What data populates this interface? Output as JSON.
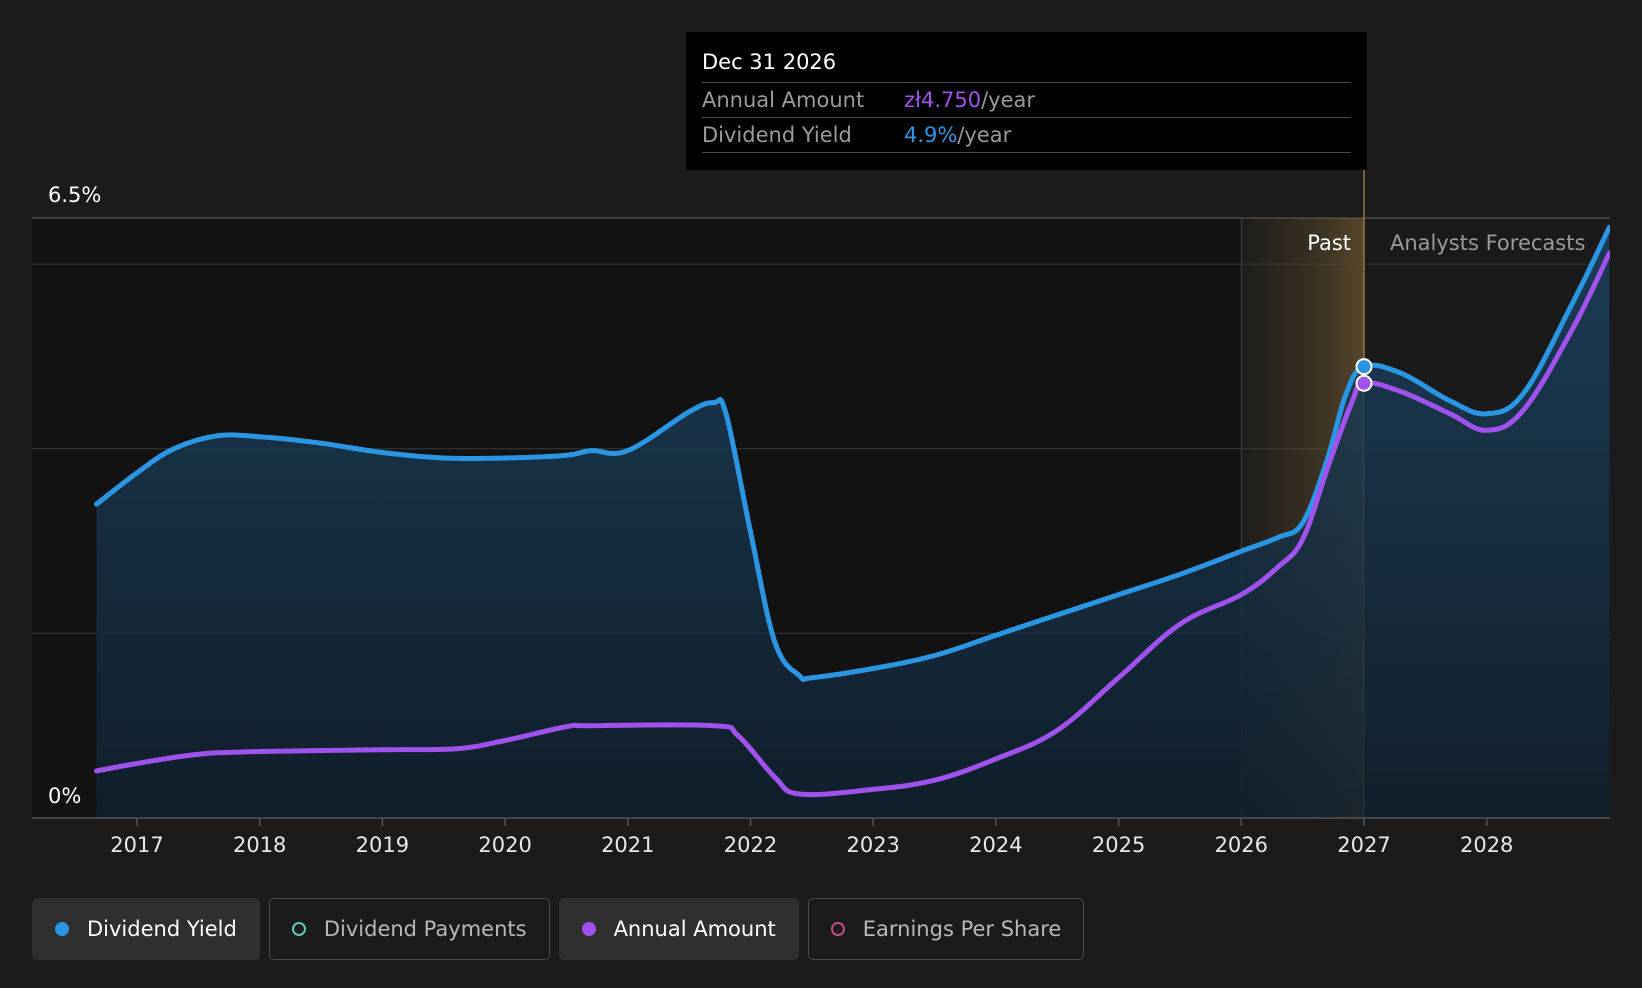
{
  "tooltip": {
    "date": "Dec 31 2026",
    "annual_amount_label": "Annual Amount",
    "annual_amount_value": "zł4.750",
    "annual_amount_unit": "/year",
    "dividend_yield_label": "Dividend Yield",
    "dividend_yield_value": "4.9%",
    "dividend_yield_unit": "/year"
  },
  "legend": [
    {
      "label": "Dividend Yield",
      "active": true,
      "color": "#2a96e3"
    },
    {
      "label": "Dividend Payments",
      "active": false,
      "color": "#5fc8b8"
    },
    {
      "label": "Annual Amount",
      "active": true,
      "color": "#a052ec"
    },
    {
      "label": "Earnings Per Share",
      "active": false,
      "color": "#c04c8c"
    }
  ],
  "chart_data": {
    "type": "line",
    "title": "",
    "xlabel": "",
    "ylabel": "",
    "ylim": [
      0,
      6.5
    ],
    "xlim": [
      2016.5,
      2029.0
    ],
    "y_tick_labels": [
      {
        "value": 6.5,
        "label": "6.5%"
      },
      {
        "value": 0,
        "label": "0%"
      }
    ],
    "grid_values": [
      6.0,
      4.0,
      2.0
    ],
    "x_ticks": [
      2017,
      2018,
      2019,
      2020,
      2021,
      2022,
      2023,
      2024,
      2025,
      2026,
      2027,
      2028
    ],
    "regions": {
      "past_label": "Past",
      "forecast_label": "Analysts Forecasts",
      "past_start": 2026.0,
      "divider": 2027.0
    },
    "highlight_x": 2027.0,
    "series": [
      {
        "name": "Dividend Yield",
        "color": "#2a96e3",
        "fill": true,
        "points": [
          [
            2016.67,
            3.4
          ],
          [
            2017.0,
            3.74
          ],
          [
            2017.3,
            4.0
          ],
          [
            2017.65,
            4.14
          ],
          [
            2018.0,
            4.13
          ],
          [
            2018.5,
            4.06
          ],
          [
            2019.0,
            3.96
          ],
          [
            2019.5,
            3.9
          ],
          [
            2020.0,
            3.9
          ],
          [
            2020.5,
            3.93
          ],
          [
            2020.7,
            3.98
          ],
          [
            2021.0,
            3.98
          ],
          [
            2021.5,
            4.4
          ],
          [
            2021.7,
            4.5
          ],
          [
            2021.8,
            4.38
          ],
          [
            2022.0,
            3.1
          ],
          [
            2022.2,
            1.9
          ],
          [
            2022.4,
            1.54
          ],
          [
            2022.5,
            1.52
          ],
          [
            2023.0,
            1.62
          ],
          [
            2023.5,
            1.76
          ],
          [
            2024.0,
            1.98
          ],
          [
            2024.5,
            2.2
          ],
          [
            2025.0,
            2.42
          ],
          [
            2025.5,
            2.64
          ],
          [
            2026.0,
            2.89
          ],
          [
            2026.3,
            3.04
          ],
          [
            2026.5,
            3.2
          ],
          [
            2026.7,
            3.88
          ],
          [
            2026.85,
            4.58
          ],
          [
            2027.0,
            4.89
          ],
          [
            2027.3,
            4.82
          ],
          [
            2027.7,
            4.52
          ],
          [
            2028.0,
            4.38
          ],
          [
            2028.3,
            4.6
          ],
          [
            2028.7,
            5.58
          ],
          [
            2029.0,
            6.4
          ]
        ]
      },
      {
        "name": "Annual Amount",
        "color": "#a052ec",
        "fill": false,
        "points": [
          [
            2016.67,
            0.51
          ],
          [
            2017.0,
            0.59
          ],
          [
            2017.5,
            0.69
          ],
          [
            2018.0,
            0.72
          ],
          [
            2019.0,
            0.74
          ],
          [
            2019.6,
            0.75
          ],
          [
            2020.0,
            0.84
          ],
          [
            2020.5,
            0.99
          ],
          [
            2020.7,
            1.0
          ],
          [
            2021.7,
            1.0
          ],
          [
            2021.9,
            0.89
          ],
          [
            2022.2,
            0.44
          ],
          [
            2022.4,
            0.26
          ],
          [
            2023.0,
            0.31
          ],
          [
            2023.5,
            0.41
          ],
          [
            2024.0,
            0.64
          ],
          [
            2024.5,
            0.95
          ],
          [
            2025.0,
            1.52
          ],
          [
            2025.5,
            2.1
          ],
          [
            2026.0,
            2.42
          ],
          [
            2026.3,
            2.72
          ],
          [
            2026.5,
            3.02
          ],
          [
            2026.7,
            3.78
          ],
          [
            2026.9,
            4.5
          ],
          [
            2027.0,
            4.71
          ],
          [
            2027.3,
            4.62
          ],
          [
            2027.7,
            4.38
          ],
          [
            2028.0,
            4.2
          ],
          [
            2028.3,
            4.42
          ],
          [
            2028.7,
            5.3
          ],
          [
            2029.0,
            6.12
          ]
        ]
      }
    ]
  }
}
